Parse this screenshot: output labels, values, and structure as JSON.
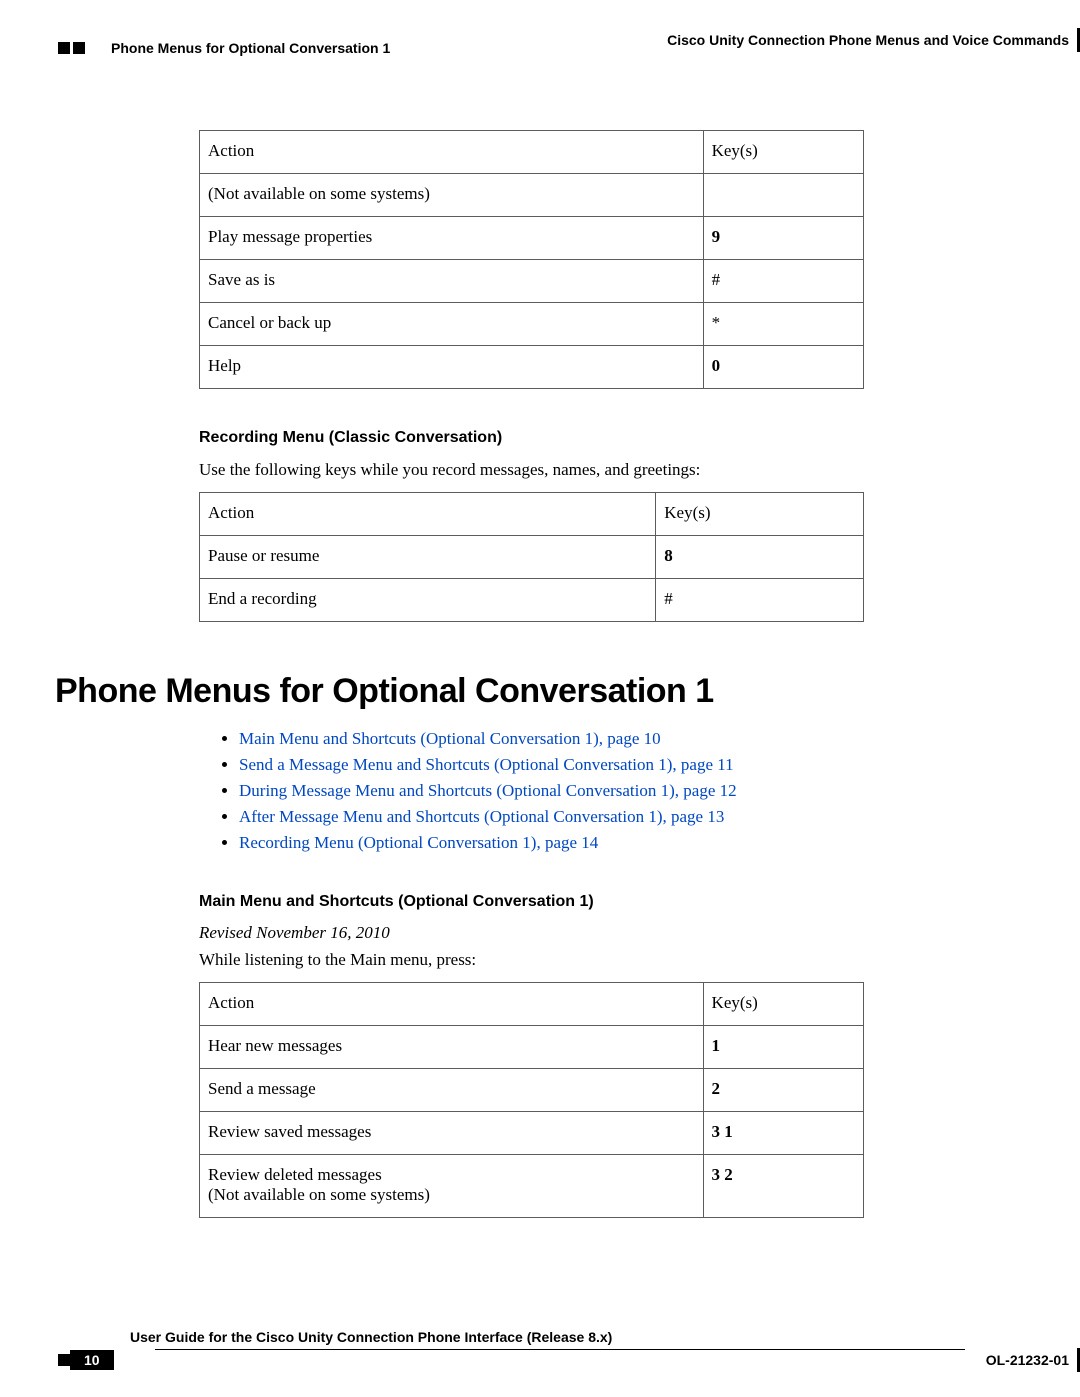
{
  "header": {
    "section_title": "Phone Menus for Optional Conversation 1",
    "doc_title": "Cisco Unity Connection Phone Menus and Voice Commands"
  },
  "footer": {
    "guide_title": "User Guide for the Cisco Unity Connection Phone Interface (Release 8.x)",
    "page_number": "10",
    "doc_id": "OL-21232-01"
  },
  "table1": {
    "headers": {
      "action": "Action",
      "key": "Key(s)"
    },
    "rows": [
      {
        "action": "(Not available on some systems)",
        "key": ""
      },
      {
        "action": "Play message properties",
        "key": "9",
        "bold": true
      },
      {
        "action": "Save as is",
        "key": "#",
        "bold": false
      },
      {
        "action": "Cancel or back up",
        "key": "*",
        "bold": false
      },
      {
        "action": "Help",
        "key": "0",
        "bold": true
      }
    ]
  },
  "recording": {
    "heading": "Recording Menu (Classic Conversation)",
    "intro": "Use the following keys while you record messages, names, and greetings:",
    "headers": {
      "action": "Action",
      "key": "Key(s)"
    },
    "rows": [
      {
        "action": "Pause or resume",
        "key": "8",
        "bold": true
      },
      {
        "action": "End a recording",
        "key": "#",
        "bold": false
      }
    ]
  },
  "section_heading": "Phone Menus for Optional Conversation 1",
  "links": [
    "Main Menu and Shortcuts (Optional Conversation 1),  page 10",
    "Send a Message Menu and Shortcuts (Optional Conversation 1),  page 11",
    "During Message Menu and Shortcuts (Optional Conversation 1),  page 12",
    "After Message Menu and Shortcuts (Optional Conversation 1),  page 13",
    "Recording Menu (Optional Conversation 1),  page 14"
  ],
  "mainmenu": {
    "heading": "Main Menu and Shortcuts (Optional Conversation 1)",
    "revised": "Revised November 16, 2010",
    "intro": "While listening to the Main menu, press:",
    "headers": {
      "action": "Action",
      "key": "Key(s)"
    },
    "rows": [
      {
        "action": "Hear new messages",
        "key": "1"
      },
      {
        "action": "Send a message",
        "key": "2"
      },
      {
        "action": "Review saved messages",
        "key": "3 1"
      },
      {
        "action": "Review deleted messages",
        "note": "(Not available on some systems)",
        "key": "3 2"
      }
    ]
  }
}
